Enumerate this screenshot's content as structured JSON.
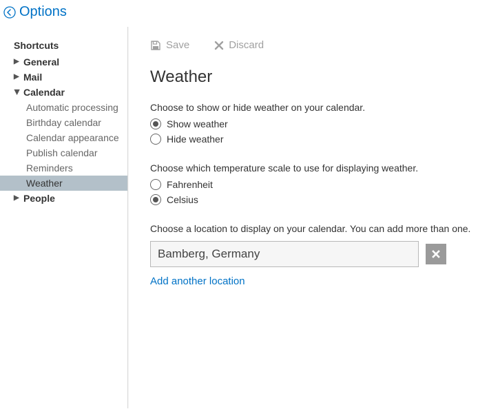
{
  "header": {
    "title": "Options"
  },
  "sidebar": {
    "shortcuts": "Shortcuts",
    "general": "General",
    "mail": "Mail",
    "calendar": "Calendar",
    "calendar_items": {
      "automatic_processing": "Automatic processing",
      "birthday_calendar": "Birthday calendar",
      "calendar_appearance": "Calendar appearance",
      "publish_calendar": "Publish calendar",
      "reminders": "Reminders",
      "weather": "Weather"
    },
    "people": "People"
  },
  "toolbar": {
    "save": "Save",
    "discard": "Discard"
  },
  "main": {
    "title": "Weather",
    "show_hide_desc": "Choose to show or hide weather on your calendar.",
    "show_label": "Show weather",
    "hide_label": "Hide weather",
    "scale_desc": "Choose which temperature scale to use for displaying weather.",
    "fahrenheit_label": "Fahrenheit",
    "celsius_label": "Celsius",
    "location_desc": "Choose a location to display on your calendar. You can add more than one.",
    "location_value": "Bamberg, Germany",
    "add_location": "Add another location"
  }
}
